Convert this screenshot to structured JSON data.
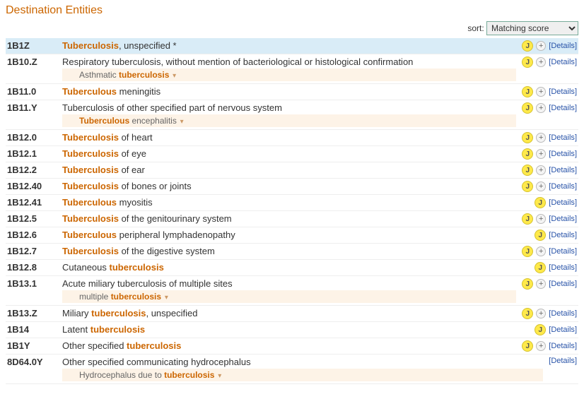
{
  "title": "Destination Entities",
  "sort": {
    "label": "sort:",
    "selected": "Matching score",
    "options": [
      "Matching score"
    ]
  },
  "details_label": "Details",
  "badge_j": "J",
  "badge_plus": "+",
  "subcaret": "▾",
  "rows": [
    {
      "code": "1B1Z",
      "parts": [
        {
          "t": "Tuberculosis",
          "hl": true
        },
        {
          "t": ", unspecified  *",
          "hl": false
        }
      ],
      "highlighted": true,
      "j": true,
      "plus": true,
      "details": true
    },
    {
      "code": "1B10.Z",
      "parts": [
        {
          "t": "Respiratory tuberculosis, without mention of bacteriological or histological confirmation",
          "hl": false
        }
      ],
      "sub": [
        {
          "t": "Asthmatic ",
          "hl": false
        },
        {
          "t": "tuberculosis",
          "hl": true
        }
      ],
      "j": true,
      "plus": true,
      "details": true
    },
    {
      "code": "1B11.0",
      "parts": [
        {
          "t": "Tuberculous",
          "hl": true
        },
        {
          "t": " meningitis",
          "hl": false
        }
      ],
      "j": true,
      "plus": true,
      "details": true
    },
    {
      "code": "1B11.Y",
      "parts": [
        {
          "t": "Tuberculosis of other specified part of nervous system",
          "hl": false
        }
      ],
      "sub": [
        {
          "t": "Tuberculous",
          "hl": true
        },
        {
          "t": " encephalitis",
          "hl": false
        }
      ],
      "j": true,
      "plus": true,
      "details": true
    },
    {
      "code": "1B12.0",
      "parts": [
        {
          "t": "Tuberculosis",
          "hl": true
        },
        {
          "t": " of heart",
          "hl": false
        }
      ],
      "j": true,
      "plus": true,
      "details": true
    },
    {
      "code": "1B12.1",
      "parts": [
        {
          "t": "Tuberculosis",
          "hl": true
        },
        {
          "t": " of eye",
          "hl": false
        }
      ],
      "j": true,
      "plus": true,
      "details": true
    },
    {
      "code": "1B12.2",
      "parts": [
        {
          "t": "Tuberculosis",
          "hl": true
        },
        {
          "t": " of ear",
          "hl": false
        }
      ],
      "j": true,
      "plus": true,
      "details": true
    },
    {
      "code": "1B12.40",
      "parts": [
        {
          "t": "Tuberculosis",
          "hl": true
        },
        {
          "t": " of bones or joints",
          "hl": false
        }
      ],
      "j": true,
      "plus": true,
      "details": true
    },
    {
      "code": "1B12.41",
      "parts": [
        {
          "t": "Tuberculous",
          "hl": true
        },
        {
          "t": " myositis",
          "hl": false
        }
      ],
      "j": true,
      "plus": false,
      "details": true
    },
    {
      "code": "1B12.5",
      "parts": [
        {
          "t": "Tuberculosis",
          "hl": true
        },
        {
          "t": " of the genitourinary system",
          "hl": false
        }
      ],
      "j": true,
      "plus": true,
      "details": true
    },
    {
      "code": "1B12.6",
      "parts": [
        {
          "t": "Tuberculous",
          "hl": true
        },
        {
          "t": " peripheral lymphadenopathy",
          "hl": false
        }
      ],
      "j": true,
      "plus": false,
      "details": true
    },
    {
      "code": "1B12.7",
      "parts": [
        {
          "t": "Tuberculosis",
          "hl": true
        },
        {
          "t": " of the digestive system",
          "hl": false
        }
      ],
      "j": true,
      "plus": true,
      "details": true
    },
    {
      "code": "1B12.8",
      "parts": [
        {
          "t": "Cutaneous ",
          "hl": false
        },
        {
          "t": "tuberculosis",
          "hl": true
        }
      ],
      "j": true,
      "plus": false,
      "details": true
    },
    {
      "code": "1B13.1",
      "parts": [
        {
          "t": "Acute miliary tuberculosis of multiple sites",
          "hl": false
        }
      ],
      "sub": [
        {
          "t": "multiple ",
          "hl": false
        },
        {
          "t": "tuberculosis",
          "hl": true
        }
      ],
      "j": true,
      "plus": true,
      "details": true
    },
    {
      "code": "1B13.Z",
      "parts": [
        {
          "t": "Miliary ",
          "hl": false
        },
        {
          "t": "tuberculosis",
          "hl": true
        },
        {
          "t": ", unspecified",
          "hl": false
        }
      ],
      "j": true,
      "plus": true,
      "details": true
    },
    {
      "code": "1B14",
      "parts": [
        {
          "t": "Latent ",
          "hl": false
        },
        {
          "t": "tuberculosis",
          "hl": true
        }
      ],
      "j": true,
      "plus": false,
      "details": true
    },
    {
      "code": "1B1Y",
      "parts": [
        {
          "t": "Other specified ",
          "hl": false
        },
        {
          "t": "tuberculosis",
          "hl": true
        }
      ],
      "j": true,
      "plus": true,
      "details": true
    },
    {
      "code": "8D64.0Y",
      "parts": [
        {
          "t": "Other specified communicating hydrocephalus",
          "hl": false
        }
      ],
      "sub": [
        {
          "t": "Hydrocephalus due to ",
          "hl": false
        },
        {
          "t": "tuberculosis",
          "hl": true
        }
      ],
      "j": false,
      "plus": false,
      "details": true
    }
  ]
}
